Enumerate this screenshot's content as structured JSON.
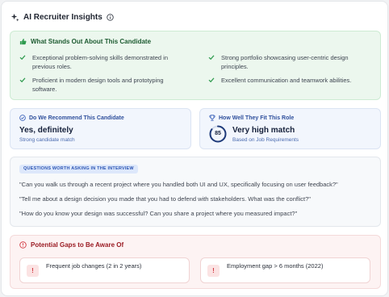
{
  "header": {
    "title": "AI Recruiter Insights"
  },
  "standouts": {
    "title": "What Stands Out About This Candidate",
    "items": [
      "Exceptional problem-solving skills demonstrated in previous roles.",
      "Strong portfolio showcasing user-centric design principles.",
      "Proficient in modern design tools and prototyping software.",
      "Excellent communication and teamwork abilities."
    ]
  },
  "recommend": {
    "label": "Do We Recommend This Candidate",
    "value": "Yes, definitely",
    "sub": "Strong candidate match"
  },
  "fit": {
    "label": "How Well They Fit This Role",
    "score": "85",
    "score_fraction": 0.85,
    "value": "Very high match",
    "sub": "Based on Job Requirements"
  },
  "questions": {
    "badge": "QUESTIONS WORTH ASKING IN THE INTERVIEW",
    "items": [
      "\"Can you walk us through a recent project where you handled both UI and UX, specifically focusing on user feedback?\"",
      "\"Tell me about a design decision you made that you had to defend with stakeholders. What was the conflict?\"",
      "\"How do you know your design was successful? Can you share a project where you measured impact?\""
    ]
  },
  "gaps": {
    "title": "Potential Gaps to Be Aware Of",
    "items": [
      {
        "icon": "!",
        "text": "Frequent job changes (2 in 2 years)"
      },
      {
        "icon": "!",
        "text": "Employment gap > 6 months (2022)"
      }
    ]
  },
  "colors": {
    "green_accent": "#2e9b4e",
    "blue_accent": "#2d56b4",
    "red_accent": "#d23a43"
  }
}
